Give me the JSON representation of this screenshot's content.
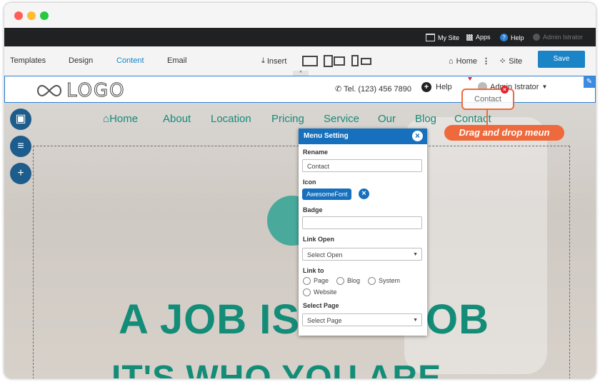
{
  "window_controls": {
    "close_color": "#ff5f57",
    "min_color": "#ffbd2e",
    "max_color": "#28c940"
  },
  "admin_bar": {
    "my_site": "My Site",
    "apps": "Apps",
    "help": "Help",
    "user": "Admin Istrator"
  },
  "toolbar": {
    "tabs": [
      "Templates",
      "Design",
      "Content",
      "Email"
    ],
    "insert": "Insert",
    "home": "Home",
    "site": "Site",
    "save": "Save",
    "accent": "#1a84c6"
  },
  "header": {
    "logo": "LOGO",
    "phone": "Tel. (123) 456 7890",
    "help": "Help",
    "user": "Admin Istrator",
    "drag_ghost": "Contact"
  },
  "nav": {
    "items": [
      "Home",
      "About",
      "Location",
      "Pricing",
      "Service",
      "Our",
      "Blog",
      "Contact"
    ]
  },
  "hero": {
    "line1_left": "A JOB IS",
    "line1_right": "OB",
    "line2": "IT'S WHO YOU ARE"
  },
  "callout": {
    "text": "Drag and drop meun"
  },
  "panel": {
    "title": "Menu Setting",
    "rename_label": "Rename",
    "rename_value": "Contact",
    "icon_label": "Icon",
    "icon_chip": "AwesomeFont",
    "badge_label": "Badge",
    "badge_value": "",
    "link_open_label": "Link Open",
    "link_open_value": "Select Open",
    "link_to_label": "Link to",
    "link_options": [
      "Page",
      "Blog",
      "System",
      "Website"
    ],
    "select_page_label": "Select Page",
    "select_page_value": "Select Page"
  }
}
